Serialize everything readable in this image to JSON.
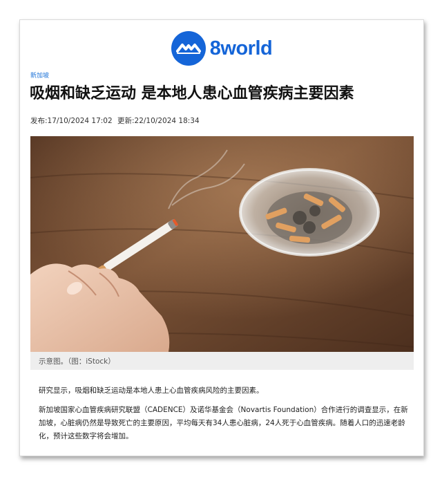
{
  "site": {
    "logo_text": "8world",
    "logo_icon": "8world-wave-logo"
  },
  "article": {
    "category": "新加坡",
    "title": "吸烟和缺乏运动 是本地人患心血管疾病主要因素",
    "published": "发布:17/10/2024 17:02",
    "updated": "更新:22/10/2024 18:34",
    "image_caption": "示意图。（图：iStock）",
    "paragraphs": [
      "研究显示，吸烟和缺乏运动是本地人患上心血管疾病风险的主要因素。",
      "新加坡国家心血管疾病研究联盟（CADENCE）及诺华基金会（Novartis Foundation）合作进行的调查显示，在新加坡，心脏病仍然是导致死亡的主要原因，平均每天有34人患心脏病，24人死于心血管疾病。随着人口的迅速老龄化，预计这些数字将会增加。"
    ]
  },
  "colors": {
    "brand": "#1565d8",
    "category": "#1e73d8",
    "caption_bg": "#eeeeee"
  }
}
